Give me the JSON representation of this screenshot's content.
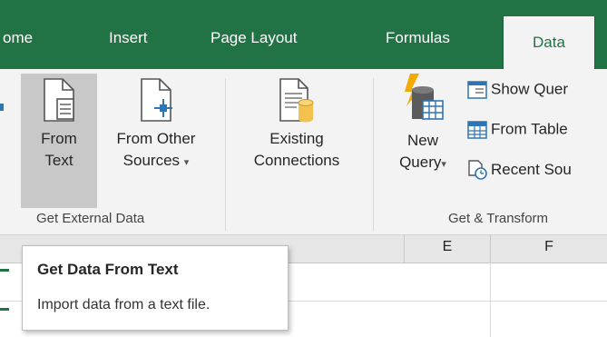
{
  "tabs": {
    "home": "ome",
    "insert": "Insert",
    "page_layout": "Page Layout",
    "formulas": "Formulas",
    "data": "Data"
  },
  "ribbon": {
    "from_text": {
      "line1": "From",
      "line2": "Text"
    },
    "from_other": {
      "line1": "From Other",
      "line2": "Sources",
      "caret": "▾"
    },
    "existing": {
      "line1": "Existing",
      "line2": "Connections"
    },
    "new_query": {
      "line1": "New",
      "line2": "Query",
      "caret": "▾"
    },
    "show_queries": "Show Quer",
    "from_table": "From Table",
    "recent_sources": "Recent Sou",
    "group_get_external": "Get External Data",
    "group_get_transform": "Get & Transform"
  },
  "sheet": {
    "col_e": "E",
    "col_f": "F"
  },
  "tooltip": {
    "title": "Get Data From Text",
    "description": "Import data from a text file."
  },
  "colors": {
    "accent": "#217346",
    "ribbon_bg": "#f3f3f3",
    "pressed_bg": "#c8c8c8"
  }
}
